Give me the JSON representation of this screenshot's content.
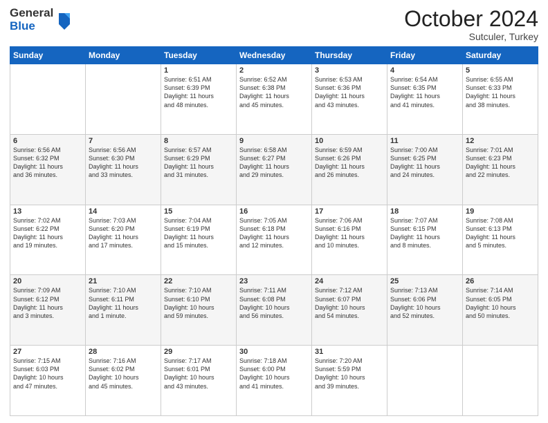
{
  "logo": {
    "general": "General",
    "blue": "Blue"
  },
  "header": {
    "month": "October 2024",
    "location": "Sutculer, Turkey"
  },
  "weekdays": [
    "Sunday",
    "Monday",
    "Tuesday",
    "Wednesday",
    "Thursday",
    "Friday",
    "Saturday"
  ],
  "weeks": [
    [
      {
        "day": "",
        "info": ""
      },
      {
        "day": "",
        "info": ""
      },
      {
        "day": "1",
        "info": "Sunrise: 6:51 AM\nSunset: 6:39 PM\nDaylight: 11 hours\nand 48 minutes."
      },
      {
        "day": "2",
        "info": "Sunrise: 6:52 AM\nSunset: 6:38 PM\nDaylight: 11 hours\nand 45 minutes."
      },
      {
        "day": "3",
        "info": "Sunrise: 6:53 AM\nSunset: 6:36 PM\nDaylight: 11 hours\nand 43 minutes."
      },
      {
        "day": "4",
        "info": "Sunrise: 6:54 AM\nSunset: 6:35 PM\nDaylight: 11 hours\nand 41 minutes."
      },
      {
        "day": "5",
        "info": "Sunrise: 6:55 AM\nSunset: 6:33 PM\nDaylight: 11 hours\nand 38 minutes."
      }
    ],
    [
      {
        "day": "6",
        "info": "Sunrise: 6:56 AM\nSunset: 6:32 PM\nDaylight: 11 hours\nand 36 minutes."
      },
      {
        "day": "7",
        "info": "Sunrise: 6:56 AM\nSunset: 6:30 PM\nDaylight: 11 hours\nand 33 minutes."
      },
      {
        "day": "8",
        "info": "Sunrise: 6:57 AM\nSunset: 6:29 PM\nDaylight: 11 hours\nand 31 minutes."
      },
      {
        "day": "9",
        "info": "Sunrise: 6:58 AM\nSunset: 6:27 PM\nDaylight: 11 hours\nand 29 minutes."
      },
      {
        "day": "10",
        "info": "Sunrise: 6:59 AM\nSunset: 6:26 PM\nDaylight: 11 hours\nand 26 minutes."
      },
      {
        "day": "11",
        "info": "Sunrise: 7:00 AM\nSunset: 6:25 PM\nDaylight: 11 hours\nand 24 minutes."
      },
      {
        "day": "12",
        "info": "Sunrise: 7:01 AM\nSunset: 6:23 PM\nDaylight: 11 hours\nand 22 minutes."
      }
    ],
    [
      {
        "day": "13",
        "info": "Sunrise: 7:02 AM\nSunset: 6:22 PM\nDaylight: 11 hours\nand 19 minutes."
      },
      {
        "day": "14",
        "info": "Sunrise: 7:03 AM\nSunset: 6:20 PM\nDaylight: 11 hours\nand 17 minutes."
      },
      {
        "day": "15",
        "info": "Sunrise: 7:04 AM\nSunset: 6:19 PM\nDaylight: 11 hours\nand 15 minutes."
      },
      {
        "day": "16",
        "info": "Sunrise: 7:05 AM\nSunset: 6:18 PM\nDaylight: 11 hours\nand 12 minutes."
      },
      {
        "day": "17",
        "info": "Sunrise: 7:06 AM\nSunset: 6:16 PM\nDaylight: 11 hours\nand 10 minutes."
      },
      {
        "day": "18",
        "info": "Sunrise: 7:07 AM\nSunset: 6:15 PM\nDaylight: 11 hours\nand 8 minutes."
      },
      {
        "day": "19",
        "info": "Sunrise: 7:08 AM\nSunset: 6:13 PM\nDaylight: 11 hours\nand 5 minutes."
      }
    ],
    [
      {
        "day": "20",
        "info": "Sunrise: 7:09 AM\nSunset: 6:12 PM\nDaylight: 11 hours\nand 3 minutes."
      },
      {
        "day": "21",
        "info": "Sunrise: 7:10 AM\nSunset: 6:11 PM\nDaylight: 11 hours\nand 1 minute."
      },
      {
        "day": "22",
        "info": "Sunrise: 7:10 AM\nSunset: 6:10 PM\nDaylight: 10 hours\nand 59 minutes."
      },
      {
        "day": "23",
        "info": "Sunrise: 7:11 AM\nSunset: 6:08 PM\nDaylight: 10 hours\nand 56 minutes."
      },
      {
        "day": "24",
        "info": "Sunrise: 7:12 AM\nSunset: 6:07 PM\nDaylight: 10 hours\nand 54 minutes."
      },
      {
        "day": "25",
        "info": "Sunrise: 7:13 AM\nSunset: 6:06 PM\nDaylight: 10 hours\nand 52 minutes."
      },
      {
        "day": "26",
        "info": "Sunrise: 7:14 AM\nSunset: 6:05 PM\nDaylight: 10 hours\nand 50 minutes."
      }
    ],
    [
      {
        "day": "27",
        "info": "Sunrise: 7:15 AM\nSunset: 6:03 PM\nDaylight: 10 hours\nand 47 minutes."
      },
      {
        "day": "28",
        "info": "Sunrise: 7:16 AM\nSunset: 6:02 PM\nDaylight: 10 hours\nand 45 minutes."
      },
      {
        "day": "29",
        "info": "Sunrise: 7:17 AM\nSunset: 6:01 PM\nDaylight: 10 hours\nand 43 minutes."
      },
      {
        "day": "30",
        "info": "Sunrise: 7:18 AM\nSunset: 6:00 PM\nDaylight: 10 hours\nand 41 minutes."
      },
      {
        "day": "31",
        "info": "Sunrise: 7:20 AM\nSunset: 5:59 PM\nDaylight: 10 hours\nand 39 minutes."
      },
      {
        "day": "",
        "info": ""
      },
      {
        "day": "",
        "info": ""
      }
    ]
  ]
}
